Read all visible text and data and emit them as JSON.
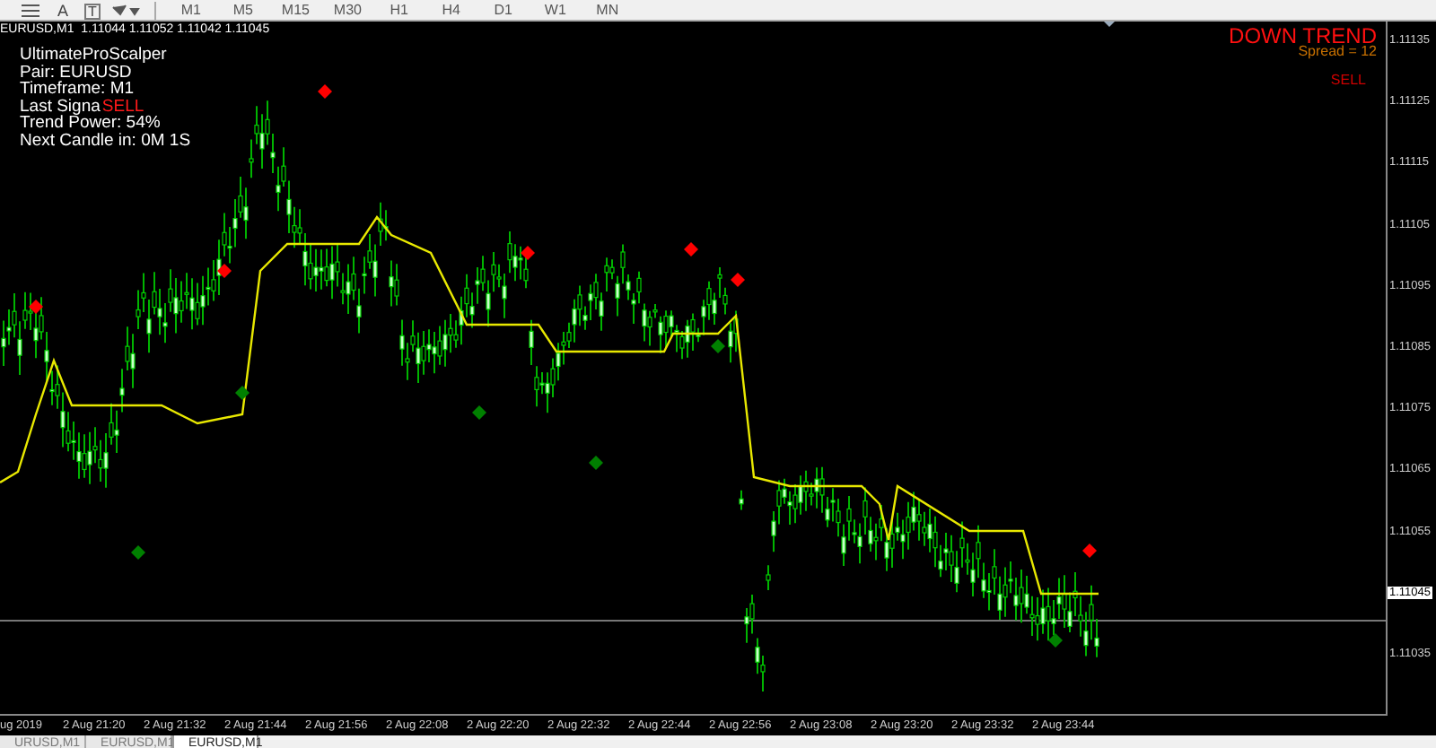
{
  "toolbar": {
    "tools": [
      "A",
      "T"
    ],
    "timeframes": [
      {
        "label": "M1"
      },
      {
        "label": "M5"
      },
      {
        "label": "M15"
      },
      {
        "label": "M30"
      },
      {
        "label": "H1"
      },
      {
        "label": "H4"
      },
      {
        "label": "D1"
      },
      {
        "label": "W1"
      },
      {
        "label": "MN"
      }
    ]
  },
  "chart": {
    "symbol": "EURUSD,M1",
    "quotes": [
      "1.11044",
      "1.11052",
      "1.11042",
      "1.11045"
    ],
    "info_lines": [
      "UltimateProScalper",
      "Pair: EURUSD",
      "Timeframe: M1"
    ],
    "last_signal": {
      "label": "Last Signa",
      "value": "SELL"
    },
    "info_lines_after": [
      "Trend Power: 54%",
      "Next Candle in: 0M 1S"
    ],
    "trend": {
      "label": "DOWN TREND",
      "spread": "Spread = 12",
      "signal": "SELL"
    }
  },
  "price_axis": [
    {
      "text": "1.11135",
      "current": false
    },
    {
      "text": "1.11125",
      "current": false
    },
    {
      "text": "1.11115",
      "current": false
    },
    {
      "text": "1.11105",
      "current": false
    },
    {
      "text": "1.11095",
      "current": false
    },
    {
      "text": "1.11085",
      "current": false
    },
    {
      "text": "1.11075",
      "current": false
    },
    {
      "text": "1.11065",
      "current": false
    },
    {
      "text": "1.11055",
      "current": false
    },
    {
      "text": "1.11045",
      "current": true
    },
    {
      "text": "1.11035",
      "current": false
    }
  ],
  "time_axis": [
    "ug 2019",
    "2 Aug 21:20",
    "2 Aug 21:32",
    "2 Aug 21:44",
    "2 Aug 21:56",
    "2 Aug 22:08",
    "2 Aug 22:20",
    "2 Aug 22:32",
    "2 Aug 22:44",
    "2 Aug 22:56",
    "2 Aug 23:08",
    "2 Aug 23:20",
    "2 Aug 23:32",
    "2 Aug 23:44"
  ],
  "tabs": [
    {
      "label": "URUSD,M1",
      "selected": false
    },
    {
      "label": "EURUSD,M1",
      "selected": false
    },
    {
      "label": "EURUSD,M1",
      "selected": true
    }
  ]
}
